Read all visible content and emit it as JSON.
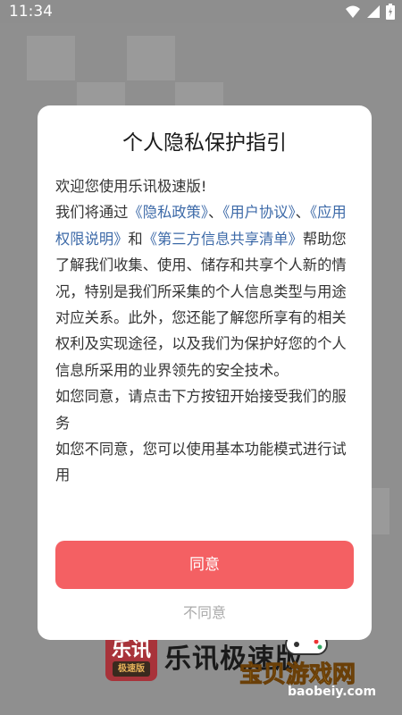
{
  "status_bar": {
    "time": "11:34",
    "icons": [
      "wifi-icon",
      "signal-icon",
      "battery-icon"
    ]
  },
  "background": {
    "app_name": "乐讯极速版",
    "logo_main": "乐讯",
    "logo_sub": "极速版"
  },
  "watermark": {
    "text": "宝贝游戏网",
    "url": "baobeiy.com"
  },
  "dialog": {
    "title": "个人隐私保护指引",
    "greeting": "欢迎您使用乐讯极速版!",
    "intro": "我们将通过",
    "link_privacy": "《隐私政策》",
    "sep1": "、",
    "link_user": "《用户协议》",
    "sep2": "、",
    "link_permission": "《应用权限说明》",
    "sep3": "和",
    "link_thirdparty": "《第三方信息共享清单》",
    "main_text": "帮助您了解我们收集、使用、储存和共享个人新的情况，特别是我们所采集的个人信息类型与用途对应关系。此外，您还能了解您所享有的相关权利及实现途径，以及我们为保护好您的个人信息所采用的业界领先的安全技术。",
    "agree_hint": "如您同意，请点击下方按钮开始接受我们的服务",
    "decline_hint": "如您不同意，您可以使用基本功能模式进行试用",
    "agree_button": "同意",
    "decline_button": "不同意"
  },
  "colors": {
    "accent": "#f46063",
    "link": "#3d6aa8",
    "overlay": "#8f8f8f"
  }
}
